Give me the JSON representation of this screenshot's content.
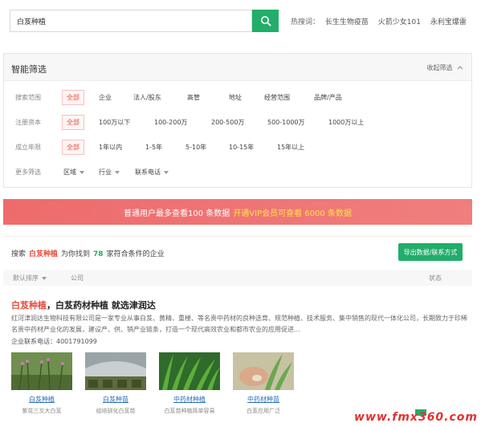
{
  "search": {
    "value": "白芨种植"
  },
  "hot": {
    "label": "热搜词：",
    "items": [
      "长生生物疫苗",
      "火箭少女101",
      "永利宝爆雷"
    ]
  },
  "filter": {
    "title": "智能筛选",
    "collapse": "收起筛选",
    "rows": [
      {
        "label": "搜索范围",
        "options": [
          "全部",
          "企业",
          "法人/股东",
          "高管",
          "地址",
          "经营范围",
          "品牌/产品"
        ]
      },
      {
        "label": "注册资本",
        "options": [
          "全部",
          "100万以下",
          "100-200万",
          "200-500万",
          "500-1000万",
          "1000万以上"
        ]
      },
      {
        "label": "成立年限",
        "options": [
          "全部",
          "1年以内",
          "1-5年",
          "5-10年",
          "10-15年",
          "15年以上"
        ]
      },
      {
        "label": "更多筛选",
        "options": [
          "区域",
          "行业",
          "联系电话"
        ]
      }
    ]
  },
  "banner": {
    "text": "普通用户最多查看100 条数据",
    "vip": "开通VIP会员可查看 6000 条数据"
  },
  "results": {
    "prefix": "搜索",
    "keyword": "白芨种植",
    "found": "为你找到",
    "count": "78",
    "suffix": "家符合条件的企业",
    "export_label": "导出数据/联系方式"
  },
  "table": {
    "sort": "默认排序",
    "company": "公司",
    "status": "状态"
  },
  "ad": {
    "title_kw": "白芨种植",
    "title_rest": "，白芨药材种植 就选津润达",
    "desc": "红河津润达生物科技有限公司是一家专业从事白芨、黄精、重楼、等名贵中药材的良种选育、规范种植、技术服务、集中销售的现代一体化公司，长期致力于珍稀名贵中药材产业化的发展，建设产、供、销产业链条，打造一个现代高效农业和都市农业的应用促进...",
    "contact": "企业联系电话：4001791099",
    "thumbs": [
      {
        "caption": "白芨种植",
        "sub": "紫花三叉大白芨"
      },
      {
        "caption": "白芨种苗",
        "sub": "组培驯化白芨苗"
      },
      {
        "caption": "中药材种植",
        "sub": "白芨苗种植简单容易"
      },
      {
        "caption": "中药材种苗",
        "sub": "白芨应用广泛"
      }
    ]
  },
  "watermark": "www.fmx360.com"
}
